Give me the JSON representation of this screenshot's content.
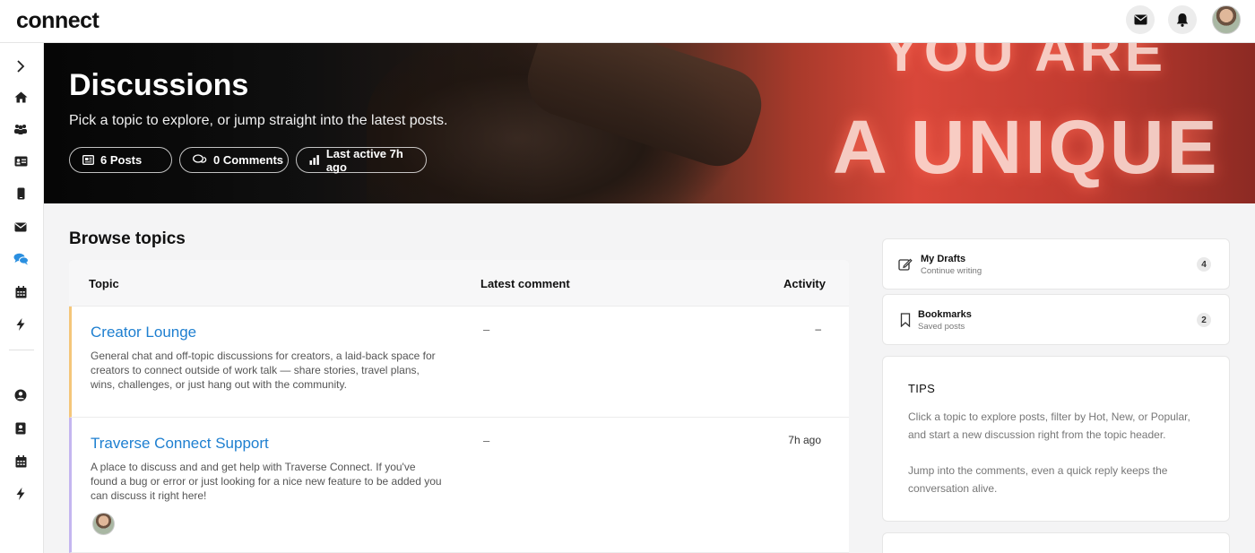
{
  "app": {
    "logo_text": "connect"
  },
  "topbar": {
    "icons": [
      "mail-icon",
      "bell-icon",
      "user-avatar"
    ]
  },
  "sidebar": {
    "items": [
      {
        "icon": "chevron-right-icon"
      },
      {
        "icon": "home-icon"
      },
      {
        "icon": "groups-icon"
      },
      {
        "icon": "id-card-icon"
      },
      {
        "icon": "phone-icon"
      },
      {
        "icon": "mail-icon"
      },
      {
        "icon": "discussions-icon",
        "active": true
      },
      {
        "icon": "calendar-icon"
      },
      {
        "icon": "bolt-icon"
      },
      {
        "icon": "user-circle-icon"
      },
      {
        "icon": "contact-book-icon"
      },
      {
        "icon": "calendar-icon"
      },
      {
        "icon": "bolt-icon"
      }
    ]
  },
  "hero": {
    "title": "Discussions",
    "subtitle": "Pick a topic to explore, or jump straight into the latest posts.",
    "stats": {
      "posts": "6 Posts",
      "comments": "0 Comments",
      "last_active": "Last active 7h ago"
    },
    "background_text": [
      "YOU ARE",
      "A UNIQUE"
    ]
  },
  "browse": {
    "title": "Browse topics",
    "columns": {
      "topic": "Topic",
      "latest": "Latest comment",
      "activity": "Activity"
    },
    "rows": [
      {
        "title": "Creator Lounge",
        "description": "General chat and off-topic discussions for creators, a laid-back space for creators to connect outside of work talk — share stories, travel plans, wins, challenges, or just hang out with the community.",
        "latest": "–",
        "activity": "–",
        "accent": "#f4c67a"
      },
      {
        "title": "Traverse Connect Support",
        "description": "A place to discuss and and get help with Traverse Connect. If you've found a bug or error or just looking for a nice new feature to be added you can discuss it right here!",
        "latest": "–",
        "activity": "7h ago",
        "accent": "#c4b6f0"
      }
    ]
  },
  "right": {
    "drafts": {
      "title": "My Drafts",
      "subtitle": "Continue writing",
      "count": "4"
    },
    "bookmarks": {
      "title": "Bookmarks",
      "subtitle": "Saved posts",
      "count": "2"
    },
    "tips": {
      "title": "TIPS",
      "p1": "Click a topic to explore posts, filter by Hot, New, or Popular, and start a new discussion right from the topic header.",
      "p2": "Jump into the comments, even a quick reply keeps the conversation alive."
    }
  },
  "colors": {
    "link": "#1e7fd0",
    "active_icon": "#2a8fe0"
  }
}
